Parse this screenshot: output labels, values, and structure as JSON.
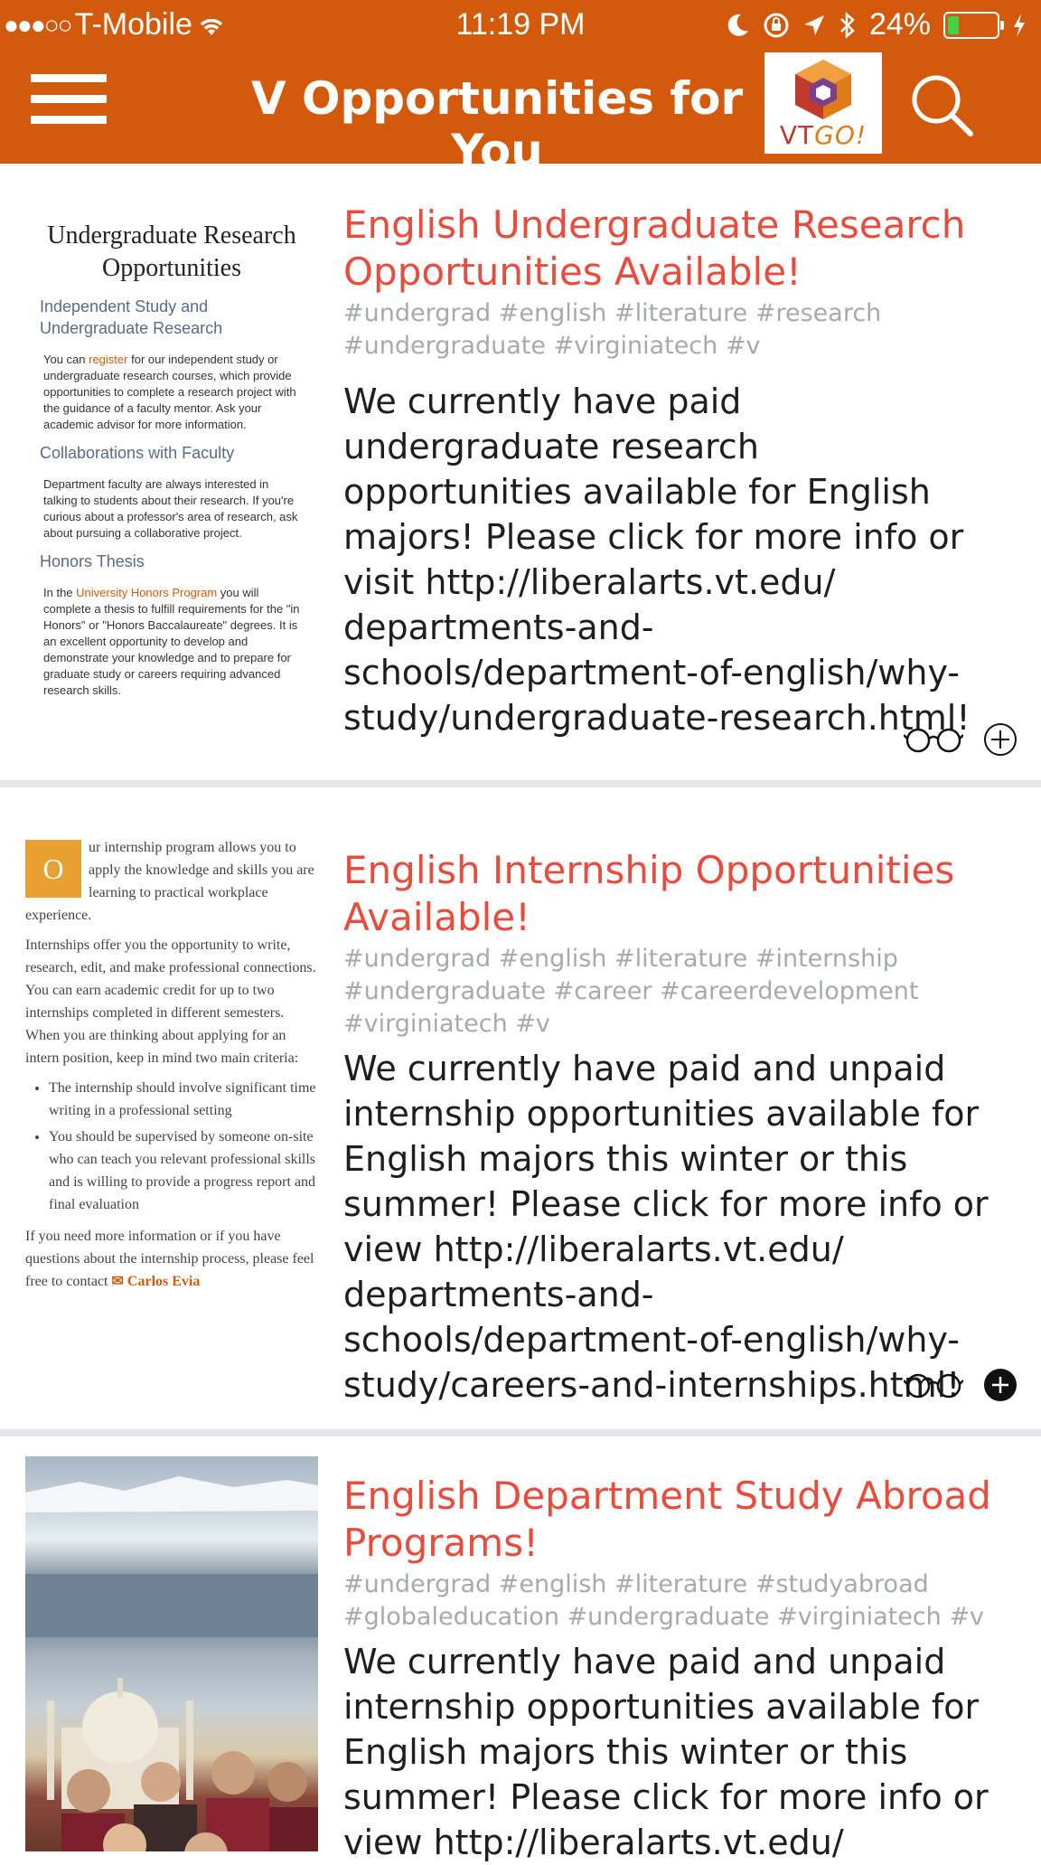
{
  "status_bar": {
    "carrier": "T-Mobile",
    "time": "11:19 PM",
    "battery": "24%"
  },
  "header": {
    "title": "V Opportunities for You",
    "logo_text_vt": "VT",
    "logo_text_go": "GO!"
  },
  "colors": {
    "brand": "#d35a0c",
    "title_red": "#e84c3d",
    "tag_gray": "#a7a9ac"
  },
  "cards": [
    {
      "title": "English Undergraduate Research Opportunities Available!",
      "tags": "#undergrad #english #literature #research #undergraduate #virginiatech #v",
      "description": "We currently have paid undergraduate research opportunities available for English majors! Please click for more info or visit http://liberalarts.vt.edu/ departments-and-schools/department-of-english/why-study/undergraduate-research.html!",
      "thumbnail": {
        "heading": "Undergraduate Research Opportunities",
        "s1": "Independent Study and Undergraduate Research",
        "p1_pre": "You can ",
        "p1_link": "register",
        "p1_post": " for our independent study or undergraduate research courses, which provide opportunities to complete a research project with the guidance of a faculty mentor. Ask your academic advisor for more information.",
        "s2": "Collaborations with Faculty",
        "p2": "Department faculty are always interested in talking to students about their research. If you're curious about a professor's area of research, ask about pursuing a collaborative project.",
        "s3": "Honors Thesis",
        "p3_pre": "In the ",
        "p3_link": "University Honors Program",
        "p3_post": " you will complete a thesis to fulfill requirements for the \"in Honors\" or \"Honors Baccalaureate\" degrees. It is an excellent opportunity to develop and demonstrate your knowledge and to prepare for graduate study or careers requiring advanced research skills."
      },
      "added": false
    },
    {
      "title": "English Internship Opportunities Available!",
      "tags": "#undergrad #english #literature #internship #undergraduate #career #careerdevelopment #virginiatech #v",
      "description": "We currently have paid and unpaid internship opportunities available for English majors this winter or this summer! Please click for more info or view http://liberalarts.vt.edu/ departments-and-schools/department-of-english/why-study/careers-and-internships.html!",
      "thumbnail": {
        "drop_cap": "O",
        "p1": "ur internship program allows you to apply the knowledge and skills you are learning to practical workplace experience.",
        "p2": "Internships offer you the opportunity to write, research, edit, and make professional connections. You can earn academic credit for up to two internships completed in different semesters. When you are thinking about applying for an intern position, keep in mind two main criteria:",
        "bullets": [
          "The internship should involve significant time writing in a professional setting",
          "You should be supervised by someone on-site who can teach you relevant professional skills and is willing to provide a progress report and final evaluation"
        ],
        "p3": "If you need more information or if you have questions about the internship process, please feel free to contact ",
        "contact": "✉ Carlos Evia"
      },
      "added": true
    },
    {
      "title": "English Department Study Abroad Programs!",
      "tags": "#undergrad #english #literature #studyabroad #globaleducation #undergraduate #virginiatech #v",
      "description": "We currently have paid and unpaid internship opportunities available for English majors this winter or this summer! Please click for more info or view http://liberalarts.vt.edu/",
      "added": false
    }
  ]
}
